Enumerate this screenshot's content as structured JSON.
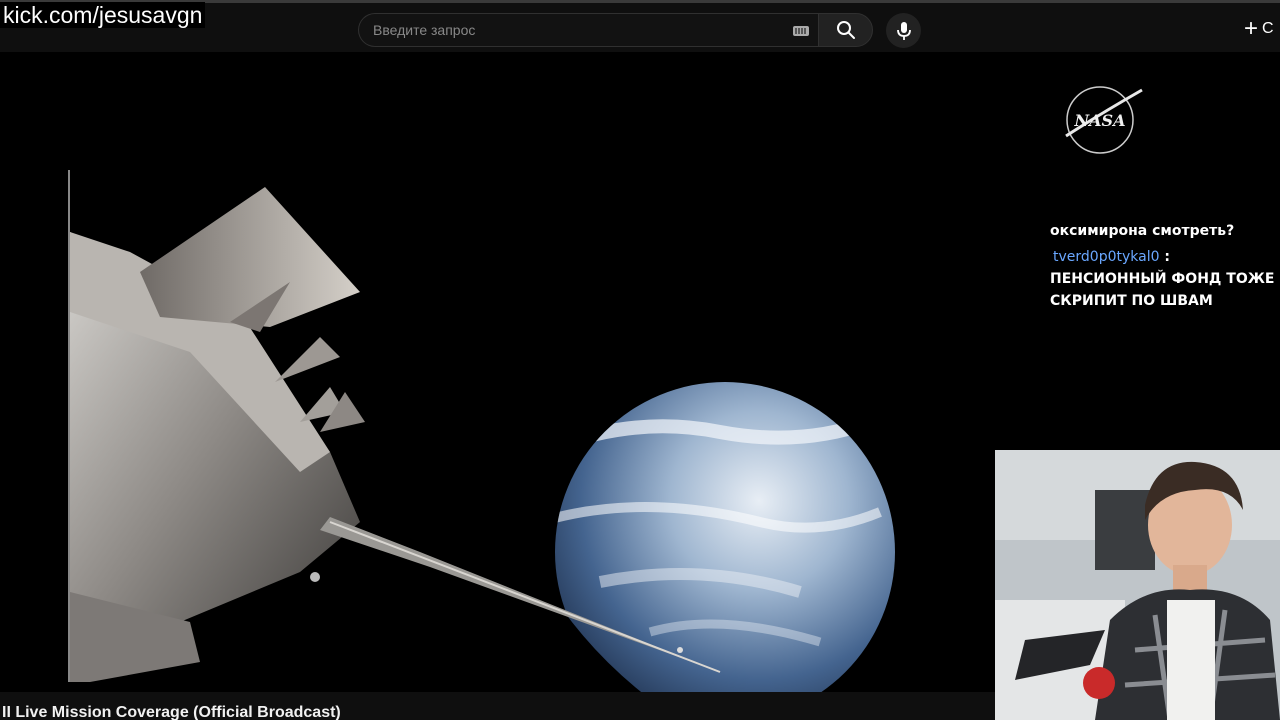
{
  "overlay": {
    "url": "kick.com/jesusavgn"
  },
  "search": {
    "placeholder": "Введите запрос"
  },
  "header": {
    "create_label": "С"
  },
  "logo": {
    "text": "NASA"
  },
  "chat": {
    "partial_line": "оксимирона смотреть?",
    "messages": [
      {
        "user": "tverd0p0tykal0",
        "separator": " : ",
        "text": "ПЕНСИОННЫЙ ФОНД ТОЖЕ СКРИПИТ ПО ШВАМ"
      }
    ]
  },
  "video": {
    "title": "II Live Mission Coverage (Official Broadcast)"
  },
  "icons": {
    "search": "search-icon",
    "mic": "mic-icon",
    "keyboard": "keyboard-icon",
    "create": "plus-icon"
  },
  "colors": {
    "chat_username": "#6aa7ff",
    "topbar": "#0f0f0f"
  }
}
